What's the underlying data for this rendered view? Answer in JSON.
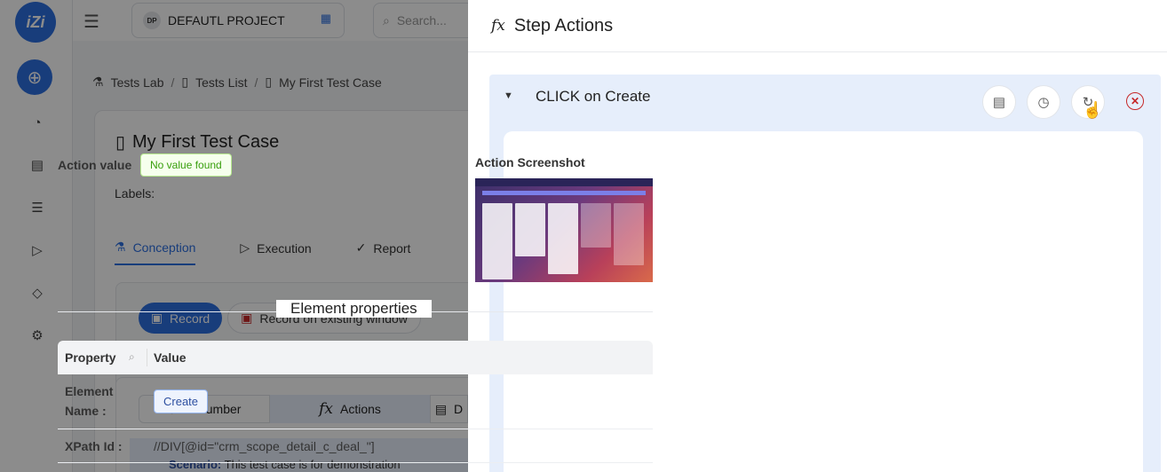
{
  "app": {
    "logo_text": "iZi",
    "project_badge": "DP",
    "project_name": "DEFAUTL PROJECT",
    "search_placeholder": "Search...",
    "breadcrumb": [
      "Tests Lab",
      "Tests List",
      "My First Test Case"
    ],
    "test_case_title": "My First Test Case",
    "labels_label": "Labels:",
    "tabs": [
      "Conception",
      "Execution",
      "Report"
    ],
    "record_label": "Record",
    "record_existing_label": "Record on existing window",
    "segments": [
      "Cucumber",
      "Actions",
      "D"
    ],
    "scenario_label": "Scenario:",
    "scenario_text": "This test case is for demonstration"
  },
  "drawer": {
    "fx_symbol": "fx",
    "title": "Step Actions",
    "step": {
      "title": "CLICK on Create",
      "action_value_label": "Action value",
      "action_value_tag": "No value found",
      "screenshot_label": "Action Screenshot",
      "element_properties_title": "Element properties",
      "table": {
        "col_property": "Property",
        "col_value": "Value",
        "rows": [
          {
            "key": "Element Name :",
            "value": "Create"
          },
          {
            "key": "XPath Id :",
            "value": "//DIV[@id=\"crm_scope_detail_c_deal_\"]"
          }
        ]
      }
    }
  },
  "colors": {
    "accent": "#2d6fe0",
    "step_bg": "#e6eefb",
    "tag_green": "#389e0d",
    "close_red": "#c62828"
  }
}
